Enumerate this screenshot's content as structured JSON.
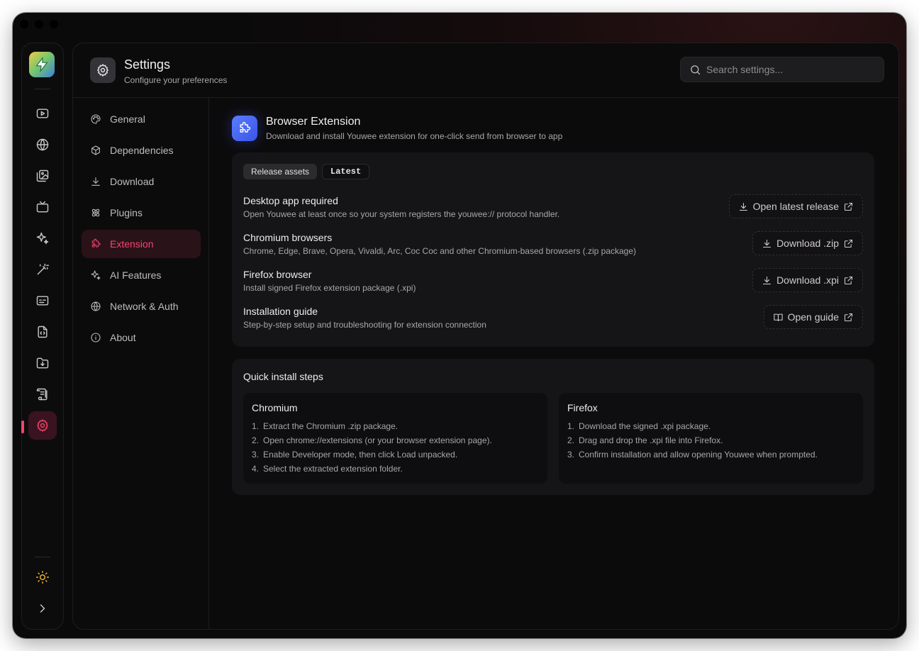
{
  "header": {
    "title": "Settings",
    "subtitle": "Configure your preferences",
    "search_placeholder": "Search settings..."
  },
  "rail": {
    "items": [
      {
        "icon": "video-icon"
      },
      {
        "icon": "globe-icon"
      },
      {
        "icon": "images-icon"
      },
      {
        "icon": "tv-icon"
      },
      {
        "icon": "sparkles-icon"
      },
      {
        "icon": "magic-wand-icon"
      },
      {
        "icon": "subtitles-icon"
      },
      {
        "icon": "file-code-icon"
      },
      {
        "icon": "folder-download-icon"
      },
      {
        "icon": "scroll-icon"
      },
      {
        "icon": "gear-icon",
        "active": true
      }
    ],
    "footer": [
      {
        "icon": "sun-icon"
      },
      {
        "icon": "chevron-right-icon"
      }
    ]
  },
  "nav": {
    "items": [
      {
        "label": "General",
        "icon": "palette-icon"
      },
      {
        "label": "Dependencies",
        "icon": "package-icon"
      },
      {
        "label": "Download",
        "icon": "download-icon"
      },
      {
        "label": "Plugins",
        "icon": "atom-icon"
      },
      {
        "label": "Extension",
        "icon": "puzzle-icon",
        "active": true
      },
      {
        "label": "AI Features",
        "icon": "sparkles-icon"
      },
      {
        "label": "Network & Auth",
        "icon": "globe-icon"
      },
      {
        "label": "About",
        "icon": "info-icon"
      }
    ]
  },
  "section": {
    "title": "Browser Extension",
    "subtitle": "Download and install Youwee extension for one-click send from browser to app"
  },
  "assets": {
    "chip_release": "Release assets",
    "chip_latest": "Latest",
    "rows": [
      {
        "title": "Desktop app required",
        "desc": "Open Youwee at least once so your system registers the youwee:// protocol handler.",
        "button": "Open latest release",
        "button_icon": "download-icon"
      },
      {
        "title": "Chromium browsers",
        "desc": "Chrome, Edge, Brave, Opera, Vivaldi, Arc, Coc Coc and other Chromium-based browsers (.zip package)",
        "button": "Download .zip",
        "button_icon": "download-icon"
      },
      {
        "title": "Firefox browser",
        "desc": "Install signed Firefox extension package (.xpi)",
        "button": "Download .xpi",
        "button_icon": "download-icon"
      },
      {
        "title": "Installation guide",
        "desc": "Step-by-step setup and troubleshooting for extension connection",
        "button": "Open guide",
        "button_icon": "book-open-icon"
      }
    ]
  },
  "quick": {
    "title": "Quick install steps",
    "chromium": {
      "title": "Chromium",
      "steps": [
        "Extract the Chromium .zip package.",
        "Open chrome://extensions (or your browser extension page).",
        "Enable Developer mode, then click Load unpacked.",
        "Select the extracted extension folder."
      ]
    },
    "firefox": {
      "title": "Firefox",
      "steps": [
        "Download the signed .xpi package.",
        "Drag and drop the .xpi file into Firefox.",
        "Confirm installation and allow opening Youwee when prompted."
      ]
    }
  },
  "colors": {
    "accent": "#f2466d",
    "extension_icon": "#4a67f5",
    "sun": "#f5b638"
  }
}
